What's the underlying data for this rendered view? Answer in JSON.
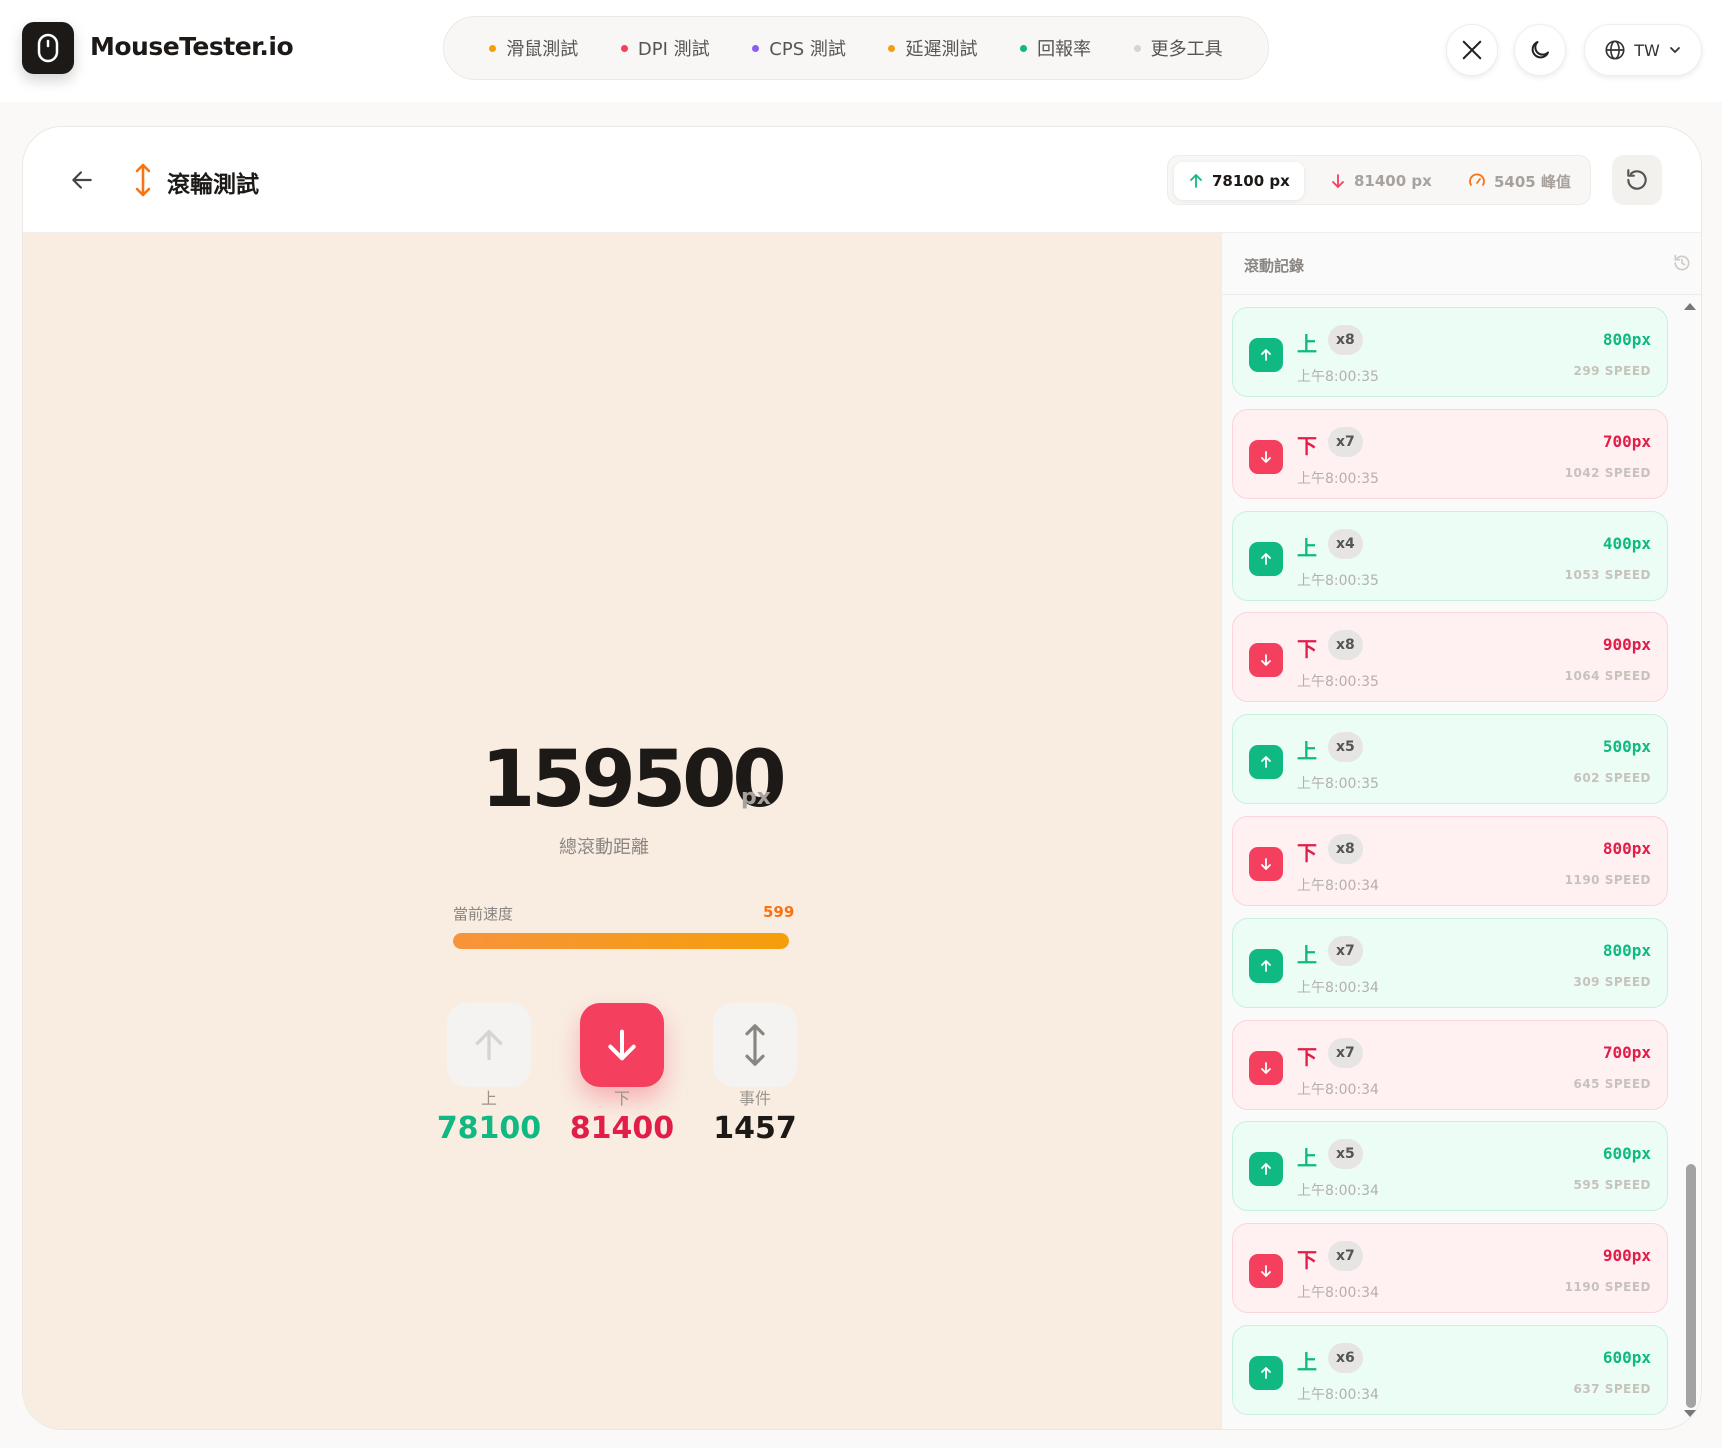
{
  "app": {
    "name": "MouseTester.io"
  },
  "nav": {
    "items": [
      {
        "label": "滑鼠測試",
        "color": "#f59e0b"
      },
      {
        "label": "DPI 測試",
        "color": "#f43f5e"
      },
      {
        "label": "CPS 測試",
        "color": "#8b5cf6"
      },
      {
        "label": "延遲測試",
        "color": "#f59e0b"
      },
      {
        "label": "回報率",
        "color": "#10b981"
      },
      {
        "label": "更多工具",
        "color": "#d4d4d4"
      }
    ],
    "lang": "TW"
  },
  "header": {
    "title": "滾輪測試",
    "stats": {
      "up": "78100 px",
      "down": "81400 px",
      "peak": "5405 峰值"
    }
  },
  "main": {
    "total": "159500",
    "total_unit": "px",
    "total_label": "總滾動距離",
    "speed_label": "當前速度",
    "speed_value": "599",
    "speed_fraction": 1.0,
    "up_label": "上",
    "up_count": "78100",
    "down_label": "下",
    "down_count": "81400",
    "events_label": "事件",
    "events_count": "1457"
  },
  "log": {
    "title": "滾動記錄",
    "items": [
      {
        "dir": "up",
        "label": "上",
        "count": "x8",
        "time": "上午8:00:35",
        "px": "800px",
        "speed": "299 SPEED"
      },
      {
        "dir": "down",
        "label": "下",
        "count": "x7",
        "time": "上午8:00:35",
        "px": "700px",
        "speed": "1042 SPEED"
      },
      {
        "dir": "up",
        "label": "上",
        "count": "x4",
        "time": "上午8:00:35",
        "px": "400px",
        "speed": "1053 SPEED"
      },
      {
        "dir": "down",
        "label": "下",
        "count": "x8",
        "time": "上午8:00:35",
        "px": "900px",
        "speed": "1064 SPEED"
      },
      {
        "dir": "up",
        "label": "上",
        "count": "x5",
        "time": "上午8:00:35",
        "px": "500px",
        "speed": "602 SPEED"
      },
      {
        "dir": "down",
        "label": "下",
        "count": "x8",
        "time": "上午8:00:34",
        "px": "800px",
        "speed": "1190 SPEED"
      },
      {
        "dir": "up",
        "label": "上",
        "count": "x7",
        "time": "上午8:00:34",
        "px": "800px",
        "speed": "309 SPEED"
      },
      {
        "dir": "down",
        "label": "下",
        "count": "x7",
        "time": "上午8:00:34",
        "px": "700px",
        "speed": "645 SPEED"
      },
      {
        "dir": "up",
        "label": "上",
        "count": "x5",
        "time": "上午8:00:34",
        "px": "600px",
        "speed": "595 SPEED"
      },
      {
        "dir": "down",
        "label": "下",
        "count": "x7",
        "time": "上午8:00:34",
        "px": "900px",
        "speed": "1190 SPEED"
      },
      {
        "dir": "up",
        "label": "上",
        "count": "x6",
        "time": "上午8:00:34",
        "px": "600px",
        "speed": "637 SPEED"
      }
    ]
  }
}
